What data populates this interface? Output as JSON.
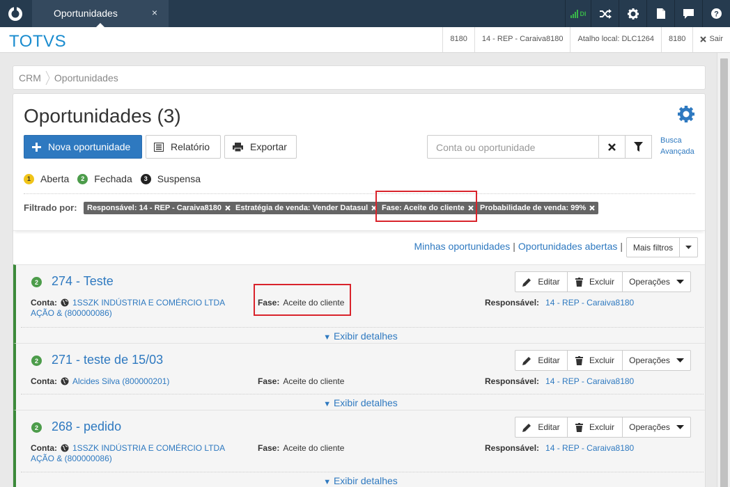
{
  "topbar": {
    "tab_label": "Oportunidades",
    "tab_close": "×",
    "signal_label": "DI"
  },
  "header": {
    "brand": "TOTVS",
    "info": [
      "8180",
      "14 - REP - Caraiva8180",
      "Atalho local: DLC1264",
      "8180"
    ],
    "logout": "Sair"
  },
  "breadcrumb": [
    "CRM",
    "Oportunidades"
  ],
  "page": {
    "title": "Oportunidades (3)",
    "new_button": "Nova oportunidade",
    "report_button": "Relatório",
    "export_button": "Exportar",
    "search_placeholder": "Conta ou oportunidade",
    "advanced_search": [
      "Busca",
      "Avançada"
    ]
  },
  "legend": [
    {
      "num": "1",
      "label": "Aberta",
      "color": "#f0c419"
    },
    {
      "num": "2",
      "label": "Fechada",
      "color": "#4c9c4a"
    },
    {
      "num": "3",
      "label": "Suspensa",
      "color": "#222222"
    }
  ],
  "filters": {
    "label": "Filtrado por:",
    "chips": [
      "Responsável: 14 - REP - Caraiva8180",
      "Estratégia de venda: Vender Datasul",
      "Fase: Aceite do cliente",
      "Probabilidade de venda: 99%"
    ]
  },
  "quick_links": {
    "mine": "Minhas oportunidades",
    "open": "Oportunidades abertas",
    "separator": "|",
    "more_filters": "Mais filtros"
  },
  "card_labels": {
    "account": "Conta:",
    "phase": "Fase:",
    "owner": "Responsável:",
    "edit": "Editar",
    "delete": "Excluir",
    "operations": "Operações",
    "details": "Exibir detalhes"
  },
  "opportunities": [
    {
      "status": "2",
      "title": "274 - Teste",
      "account_line1": "1SSZK INDÚSTRIA E COMÉRCIO LTDA",
      "account_line2": "AÇÃO & (800000086)",
      "phase": "Aceite do cliente",
      "owner": "14 - REP - Caraiva8180"
    },
    {
      "status": "2",
      "title": "271 - teste de 15/03",
      "account_line1": "Alcides Silva (800000201)",
      "account_line2": "",
      "phase": "Aceite do cliente",
      "owner": "14 - REP - Caraiva8180"
    },
    {
      "status": "2",
      "title": "268 - pedido",
      "account_line1": "1SSZK INDÚSTRIA E COMÉRCIO LTDA",
      "account_line2": "AÇÃO & (800000086)",
      "phase": "Aceite do cliente",
      "owner": "14 - REP - Caraiva8180"
    }
  ]
}
